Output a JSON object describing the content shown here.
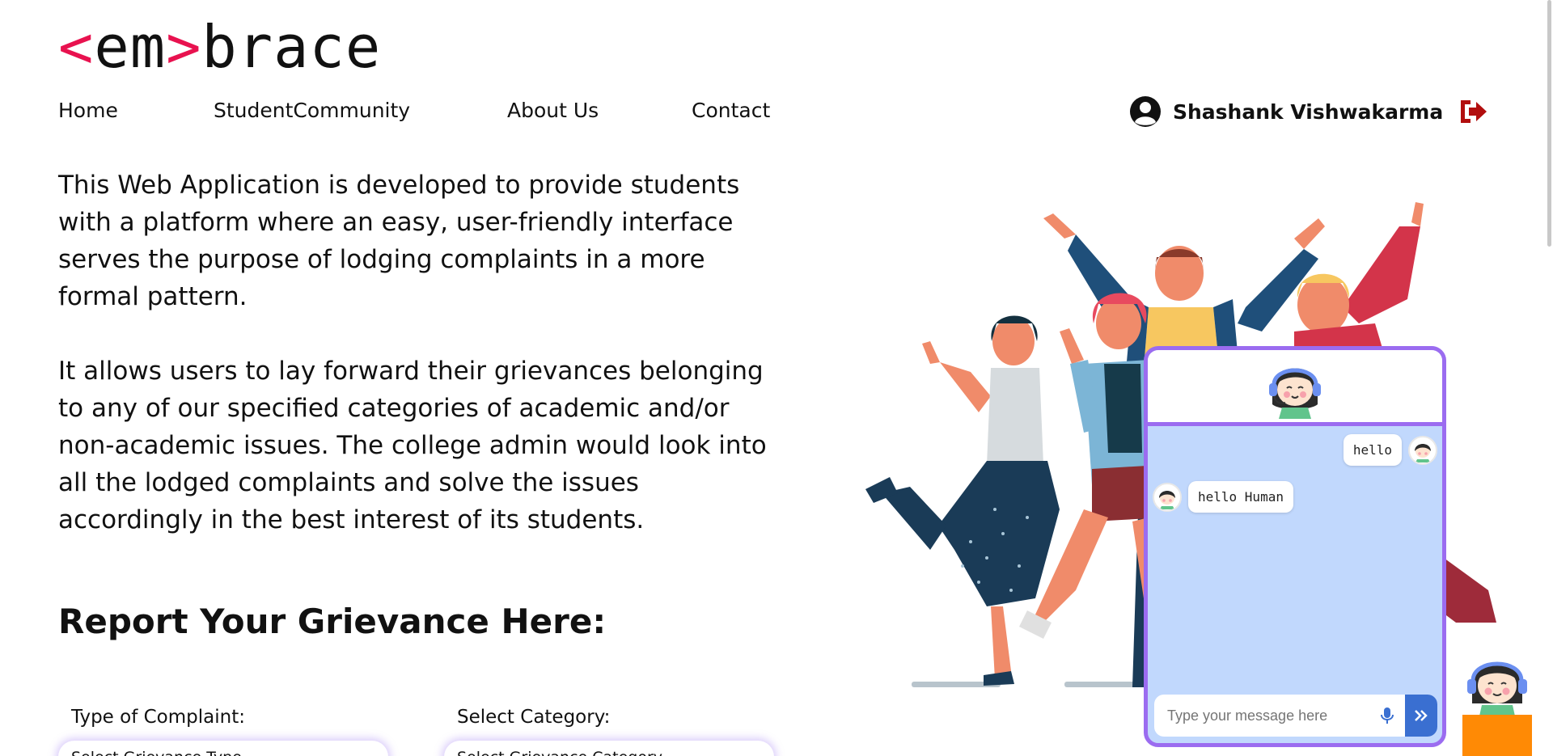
{
  "logo": {
    "open": "<",
    "em": "em",
    "close": ">",
    "rest": "brace"
  },
  "nav": [
    {
      "label": "Home"
    },
    {
      "label": "StudentCommunity"
    },
    {
      "label": "About Us"
    },
    {
      "label": "Contact"
    }
  ],
  "user": {
    "name": "Shashank Vishwakarma"
  },
  "intro": {
    "p1": "This Web Application is developed to provide students with a platform where an easy, user-friendly interface serves the purpose of lodging complaints in a more formal pattern.",
    "p2": "It allows users to lay forward their grievances belonging to any of our specified categories of academic and/or non-academic issues. The college admin would look into all the lodged complaints and solve the issues accordingly in the best interest of its students."
  },
  "report": {
    "title": "Report Your Grievance Here:",
    "type_label": "Type of Complaint:",
    "type_value": "Select Grievance Type",
    "category_label": "Select Category:",
    "category_value": "Select Grievance Category"
  },
  "chat": {
    "messages": [
      {
        "from": "user",
        "text": "hello"
      },
      {
        "from": "bot",
        "text": "hello Human"
      }
    ],
    "input_placeholder": "Type your message here"
  },
  "colors": {
    "accent": "#e8124f",
    "chat_border": "#9b6cf0",
    "chat_bg": "#c1d8fd",
    "send": "#3a6fd1",
    "logout": "#b20e0e",
    "orange": "#ff8a05"
  },
  "icons": [
    "user-circle-icon",
    "logout-icon",
    "chatbot-avatar-icon",
    "microphone-icon",
    "double-chevron-right-icon"
  ]
}
